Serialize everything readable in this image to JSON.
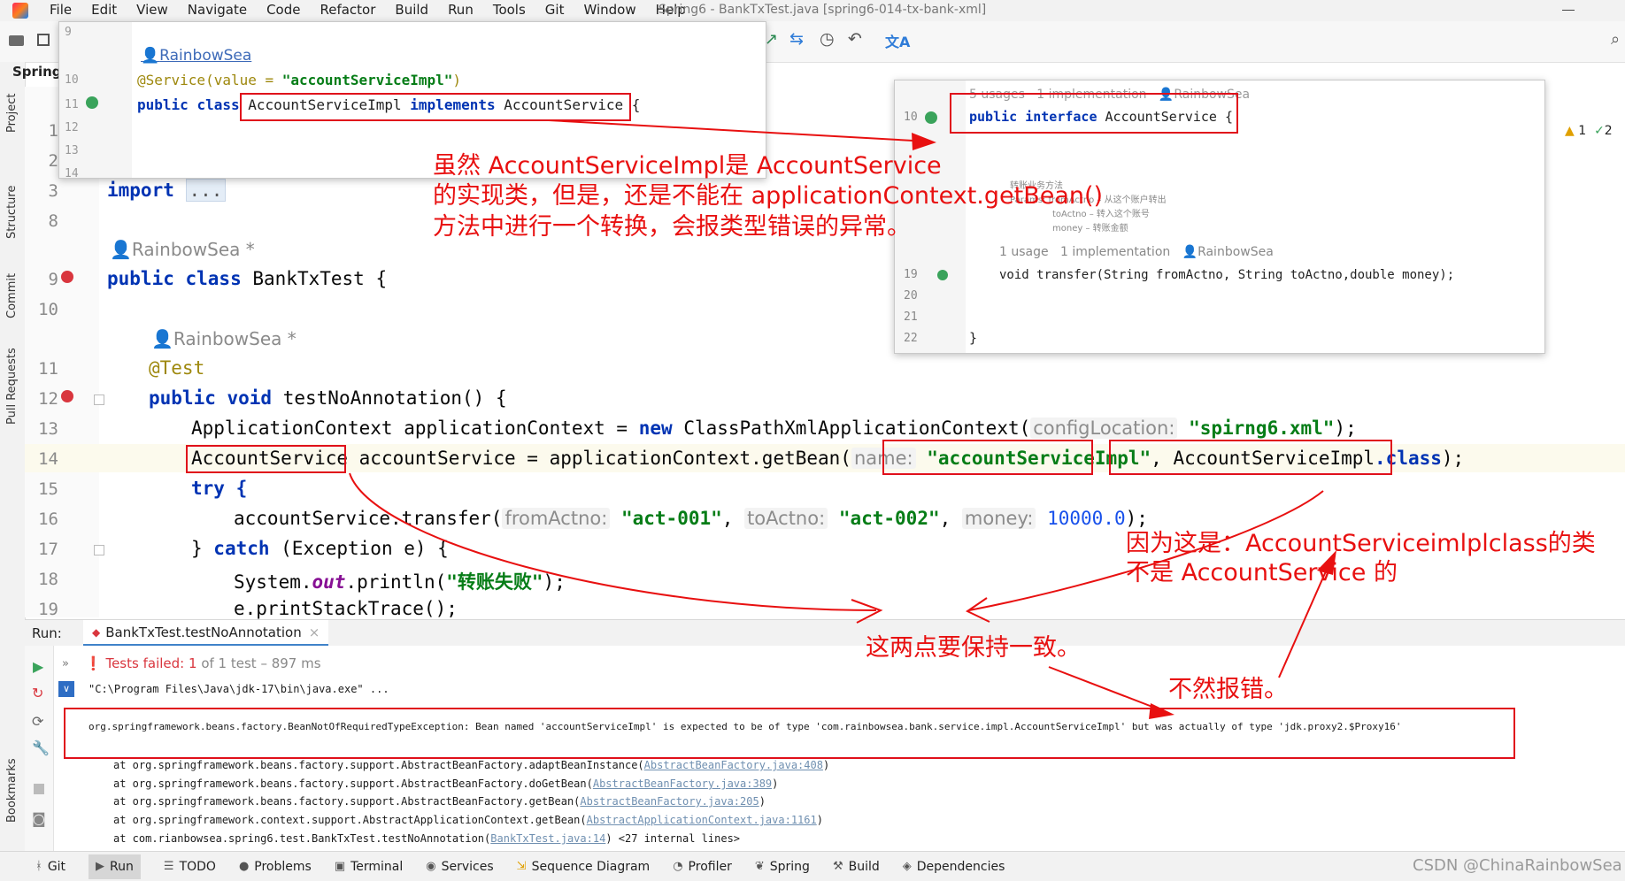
{
  "menu": [
    "File",
    "Edit",
    "View",
    "Navigate",
    "Code",
    "Refactor",
    "Build",
    "Run",
    "Tools",
    "Git",
    "Window",
    "Help"
  ],
  "window_title": "Spring6 - BankTxTest.java [spring6-014-tx-bank-xml]",
  "project_label": "Spring",
  "side_tabs": [
    "Project",
    "Structure",
    "Commit",
    "Pull Requests",
    "Bookmarks"
  ],
  "popup_left": {
    "line_numbers": [
      "9",
      "10",
      "11",
      "12",
      "13",
      "14"
    ],
    "author": "RainbowSea",
    "annotation": "@Service(value = ",
    "annotation_value": "\"accountServiceImpl\"",
    "annotation_close": ")",
    "kw_public": "public",
    "kw_class": "class",
    "class_decl": "AccountServiceImpl implements AccountService",
    "class_decl_name": "AccountServiceImpl",
    "class_decl_implements": "implements",
    "class_decl_iface": "AccountService",
    "brace": "{"
  },
  "popup_right": {
    "usages_top": "5 usages",
    "impl_top": "1 implementation",
    "author_top": "RainbowSea",
    "line10": "10",
    "iface_kw": "public interface",
    "iface_name": "AccountService",
    "brace": "{",
    "doc_title": "转账业务方法",
    "doc_params": "Params:",
    "doc_p1": "fromActno – 从这个账户转出",
    "doc_p2": "toActno – 转入这个账号",
    "doc_p3": "money – 转账金额",
    "usages2": "1 usage",
    "impl2": "1 implementation",
    "author2": "RainbowSea",
    "line_numbers": [
      "19",
      "20",
      "21",
      "22"
    ],
    "method": "void transfer(String fromActno, String toActno,double money);",
    "close_brace": "}"
  },
  "warnings": {
    "warn_count": "1",
    "ok_count": "2"
  },
  "editor": {
    "line_numbers": [
      "1",
      "2",
      "3",
      "8",
      "9",
      "10",
      "11",
      "12",
      "13",
      "14",
      "15",
      "16",
      "17",
      "18",
      "19"
    ],
    "import_kw": "import",
    "import_dots": "...",
    "author1": "RainbowSea *",
    "class_line_kw": "public class",
    "class_line_name": "BankTxTest",
    "class_line_brace": "{",
    "author2": "RainbowSea *",
    "test_ann": "@Test",
    "method_kw": "public void",
    "method_name": "testNoAnnotation() {",
    "l13_a": "ApplicationContext applicationContext = ",
    "l13_new": "new",
    "l13_b": " ClassPathXmlApplicationContext(",
    "l13_hint": "configLocation:",
    "l13_str": "\"spirng6.xml\"",
    "l13_end": ");",
    "l14_type": "AccountService",
    "l14_a": " accountService = applicationContext.getBean(",
    "l14_hint": "name:",
    "l14_str": "\"accountServiceImpl\"",
    "l14_comma": ",",
    "l14_class": "AccountServiceImpl",
    "l14_dotclass": ".class",
    "l14_end": ");",
    "l15": "try {",
    "l16_a": "accountService.transfer(",
    "l16_h1": "fromActno:",
    "l16_s1": "\"act-001\"",
    "l16_h2": "toActno:",
    "l16_s2": "\"act-002\"",
    "l16_h3": "money:",
    "l16_num": "10000.0",
    "l16_end": ");",
    "l17_a": "} ",
    "l17_catch": "catch",
    "l17_b": " (Exception e) {",
    "l18_a": "System.",
    "l18_out": "out",
    "l18_b": ".println(",
    "l18_str": "\"转账失败\"",
    "l18_end": ");",
    "l19": "e.printStackTrace();"
  },
  "run": {
    "label": "Run:",
    "tab": "BankTxTest.testNoAnnotation",
    "tests_failed": "Tests failed:",
    "failed_count": "1",
    "of_total": "of 1 test",
    "duration": "– 897 ms",
    "cmd": "\"C:\\Program Files\\Java\\jdk-17\\bin\\java.exe\" ...",
    "exception": "org.springframework.beans.factory.BeanNotOfRequiredTypeException: Bean named 'accountServiceImpl' is expected to be of type 'com.rainbowsea.bank.service.impl.AccountServiceImpl' but was actually of type 'jdk.proxy2.$Proxy16'",
    "trace": [
      {
        "text": "at org.springframework.beans.factory.support.AbstractBeanFactory.adaptBeanInstance(",
        "link": "AbstractBeanFactory.java:408",
        "end": ")"
      },
      {
        "text": "at org.springframework.beans.factory.support.AbstractBeanFactory.doGetBean(",
        "link": "AbstractBeanFactory.java:389",
        "end": ")"
      },
      {
        "text": "at org.springframework.beans.factory.support.AbstractBeanFactory.getBean(",
        "link": "AbstractBeanFactory.java:205",
        "end": ")"
      },
      {
        "text": "at org.springframework.context.support.AbstractApplicationContext.getBean(",
        "link": "AbstractApplicationContext.java:1161",
        "end": ")"
      },
      {
        "text": "at com.rianbowsea.spring6.test.BankTxTest.testNoAnnotation(",
        "link": "BankTxTest.java:14",
        "end": ") <27 internal lines>"
      }
    ]
  },
  "annotations": {
    "note1_l1": "虽然 AccountServiceImpl是 AccountService",
    "note1_l2": "的实现类，但是，还是不能在 applicationContext.getBean()",
    "note1_l3": "方法中进行一个转换，会报类型错误的异常。",
    "note2_l1": "因为这是：AccountServiceimlplclass的类",
    "note2_l2": "不是 AccountService 的",
    "note3": "这两点要保持一致。",
    "note4": "不然报错。"
  },
  "bottom_tabs": [
    "Git",
    "Run",
    "TODO",
    "Problems",
    "Terminal",
    "Services",
    "Sequence Diagram",
    "Profiler",
    "Spring",
    "Build",
    "Dependencies"
  ],
  "watermark": "CSDN @ChinaRainbowSea"
}
